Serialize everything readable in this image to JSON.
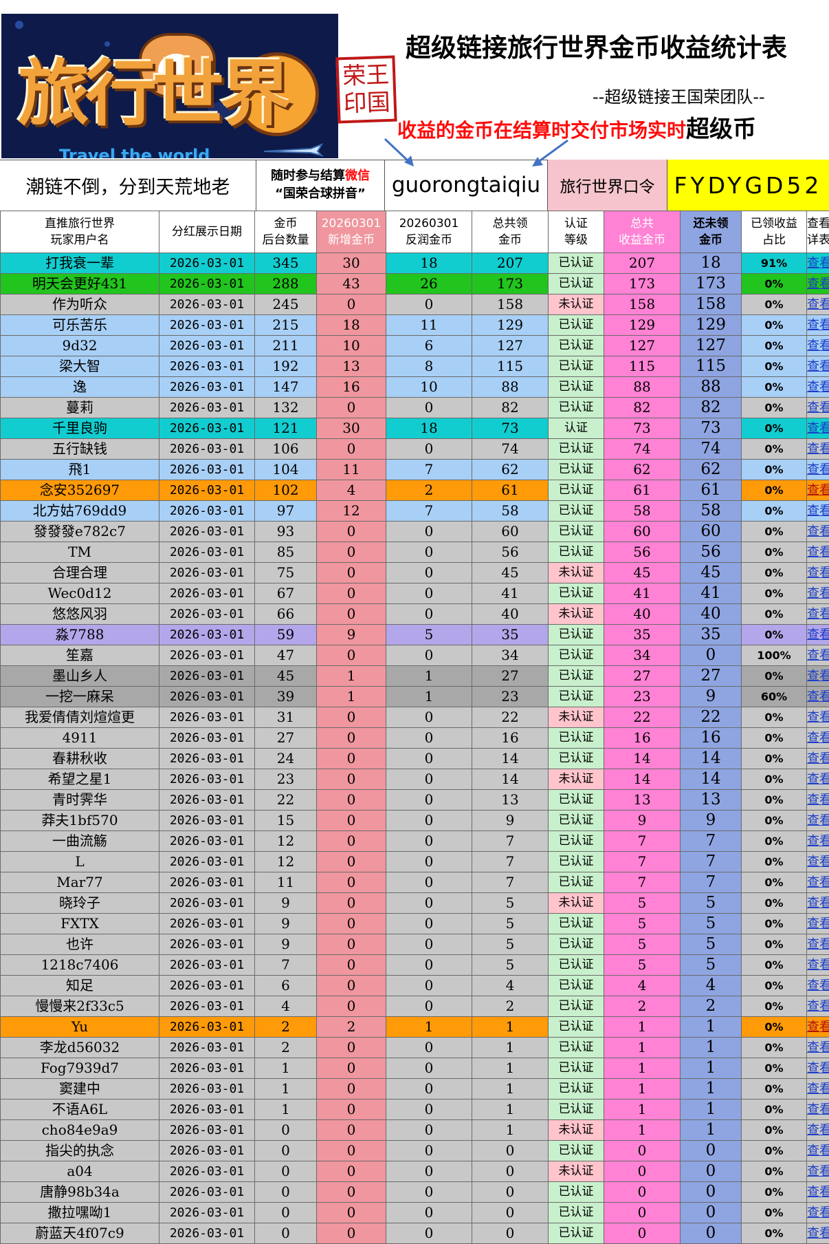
{
  "banner": {
    "logo_text": "旅行世界",
    "logo_sub": "Travel the world",
    "stamp_chars": [
      "荣",
      "王",
      "印",
      "国"
    ],
    "title": "超级链接旅行世界金币收益统计表",
    "team": "--超级链接王国荣团队--",
    "notice_red": "收益的金币在结算时交付市场实时",
    "notice_black": "超级币"
  },
  "info": {
    "slogan": "潮链不倒，分到天荒地老",
    "join_line1_a": "随时参与结算",
    "join_line1_b": "微信",
    "join_line2": "“国荣合球拼音”",
    "wechat_id": "guorongtaiqiu",
    "code_label": "旅行世界口令",
    "code_value": "FYDYGD52"
  },
  "headers": {
    "col1": [
      "直推旅行世界",
      "玩家用户名"
    ],
    "col2": [
      "分红展示日期"
    ],
    "col3": [
      "金币",
      "后台数量"
    ],
    "col4": [
      "20260301",
      "新增金币"
    ],
    "col5": [
      "20260301",
      "反润金币"
    ],
    "col6": [
      "总共领",
      "金币"
    ],
    "col7": [
      "认证",
      "等级"
    ],
    "col8": [
      "总共",
      "收益金币"
    ],
    "col9": [
      "还未领",
      "金币"
    ],
    "col10": [
      "已领收益",
      "占比"
    ],
    "col11": [
      "查看",
      "详表"
    ]
  },
  "link_text": "查看",
  "colors": {
    "teal": "#12cdd0",
    "green": "#22c41e",
    "gray": "#c8c8c8",
    "blue": "#a8cff6",
    "orange": "#ff9a08",
    "purple": "#b4a6ea",
    "darkgray": "#a8a8a8",
    "pink_new": "#f0969e",
    "pink_total": "#ff82d4",
    "cert_green": "#c8f0cc",
    "cert_pink": "#ffc4cc",
    "unclaimed": "#8fa5e2",
    "code_bg": "#ffff00",
    "code_label_bg": "#f5c4cc"
  },
  "rows": [
    {
      "name": "打我衰一辈",
      "date": "2026-03-01",
      "backend": "345",
      "added": "30",
      "rebate": "18",
      "claimed": "207",
      "cert": "已认证",
      "total": "207",
      "unclaimed": "18",
      "pct": "91%",
      "style": "teal"
    },
    {
      "name": "明天会更好431",
      "date": "2026-03-01",
      "backend": "288",
      "added": "43",
      "rebate": "26",
      "claimed": "173",
      "cert": "已认证",
      "total": "173",
      "unclaimed": "173",
      "pct": "0%",
      "style": "green"
    },
    {
      "name": "作为听众",
      "date": "2026-03-01",
      "backend": "245",
      "added": "0",
      "rebate": "0",
      "claimed": "158",
      "cert": "未认证",
      "total": "158",
      "unclaimed": "158",
      "pct": "0%",
      "style": "gray"
    },
    {
      "name": "可乐苦乐",
      "date": "2026-03-01",
      "backend": "215",
      "added": "18",
      "rebate": "11",
      "claimed": "129",
      "cert": "已认证",
      "total": "129",
      "unclaimed": "129",
      "pct": "0%",
      "style": "blue"
    },
    {
      "name": "9d32",
      "date": "2026-03-01",
      "backend": "211",
      "added": "10",
      "rebate": "6",
      "claimed": "127",
      "cert": "已认证",
      "total": "127",
      "unclaimed": "127",
      "pct": "0%",
      "style": "blue"
    },
    {
      "name": "梁大智",
      "date": "2026-03-01",
      "backend": "192",
      "added": "13",
      "rebate": "8",
      "claimed": "115",
      "cert": "已认证",
      "total": "115",
      "unclaimed": "115",
      "pct": "0%",
      "style": "blue"
    },
    {
      "name": "逸",
      "date": "2026-03-01",
      "backend": "147",
      "added": "16",
      "rebate": "10",
      "claimed": "88",
      "cert": "已认证",
      "total": "88",
      "unclaimed": "88",
      "pct": "0%",
      "style": "blue"
    },
    {
      "name": "蔓莉",
      "date": "2026-03-01",
      "backend": "132",
      "added": "0",
      "rebate": "0",
      "claimed": "82",
      "cert": "已认证",
      "total": "82",
      "unclaimed": "82",
      "pct": "0%",
      "style": "gray"
    },
    {
      "name": "千里良驹",
      "date": "2026-03-01",
      "backend": "121",
      "added": "30",
      "rebate": "18",
      "claimed": "73",
      "cert": "认证",
      "total": "73",
      "unclaimed": "73",
      "pct": "0%",
      "style": "teal"
    },
    {
      "name": "五行缺钱",
      "date": "2026-03-01",
      "backend": "106",
      "added": "0",
      "rebate": "0",
      "claimed": "74",
      "cert": "已认证",
      "total": "74",
      "unclaimed": "74",
      "pct": "0%",
      "style": "gray"
    },
    {
      "name": "飛1",
      "date": "2026-03-01",
      "backend": "104",
      "added": "11",
      "rebate": "7",
      "claimed": "62",
      "cert": "已认证",
      "total": "62",
      "unclaimed": "62",
      "pct": "0%",
      "style": "blue"
    },
    {
      "name": "念安352697",
      "date": "2026-03-01",
      "backend": "102",
      "added": "4",
      "rebate": "2",
      "claimed": "61",
      "cert": "已认证",
      "total": "61",
      "unclaimed": "61",
      "pct": "0%",
      "style": "orange"
    },
    {
      "name": "北方姑769dd9",
      "date": "2026-03-01",
      "backend": "97",
      "added": "12",
      "rebate": "7",
      "claimed": "58",
      "cert": "已认证",
      "total": "58",
      "unclaimed": "58",
      "pct": "0%",
      "style": "blue"
    },
    {
      "name": "發發發e782c7",
      "date": "2026-03-01",
      "backend": "93",
      "added": "0",
      "rebate": "0",
      "claimed": "60",
      "cert": "已认证",
      "total": "60",
      "unclaimed": "60",
      "pct": "0%",
      "style": "gray"
    },
    {
      "name": "TM",
      "date": "2026-03-01",
      "backend": "85",
      "added": "0",
      "rebate": "0",
      "claimed": "56",
      "cert": "已认证",
      "total": "56",
      "unclaimed": "56",
      "pct": "0%",
      "style": "gray"
    },
    {
      "name": "合理合理",
      "date": "2026-03-01",
      "backend": "75",
      "added": "0",
      "rebate": "0",
      "claimed": "45",
      "cert": "未认证",
      "total": "45",
      "unclaimed": "45",
      "pct": "0%",
      "style": "gray"
    },
    {
      "name": "Wec0d12",
      "date": "2026-03-01",
      "backend": "67",
      "added": "0",
      "rebate": "0",
      "claimed": "41",
      "cert": "已认证",
      "total": "41",
      "unclaimed": "41",
      "pct": "0%",
      "style": "gray"
    },
    {
      "name": "悠悠风羽",
      "date": "2026-03-01",
      "backend": "66",
      "added": "0",
      "rebate": "0",
      "claimed": "40",
      "cert": "未认证",
      "total": "40",
      "unclaimed": "40",
      "pct": "0%",
      "style": "gray"
    },
    {
      "name": "淼7788",
      "date": "2026-03-01",
      "backend": "59",
      "added": "9",
      "rebate": "5",
      "claimed": "35",
      "cert": "已认证",
      "total": "35",
      "unclaimed": "35",
      "pct": "0%",
      "style": "purple"
    },
    {
      "name": "笙嘉",
      "date": "2026-03-01",
      "backend": "47",
      "added": "0",
      "rebate": "0",
      "claimed": "34",
      "cert": "已认证",
      "total": "34",
      "unclaimed": "0",
      "pct": "100%",
      "style": "gray"
    },
    {
      "name": "墨山乡人",
      "date": "2026-03-01",
      "backend": "45",
      "added": "1",
      "rebate": "1",
      "claimed": "27",
      "cert": "已认证",
      "total": "27",
      "unclaimed": "27",
      "pct": "0%",
      "style": "darkgray"
    },
    {
      "name": "一挖一麻呆",
      "date": "2026-03-01",
      "backend": "39",
      "added": "1",
      "rebate": "1",
      "claimed": "23",
      "cert": "已认证",
      "total": "23",
      "unclaimed": "9",
      "pct": "60%",
      "style": "darkgray"
    },
    {
      "name": "我爱倩倩刘煊煊更",
      "date": "2026-03-01",
      "backend": "31",
      "added": "0",
      "rebate": "0",
      "claimed": "22",
      "cert": "未认证",
      "total": "22",
      "unclaimed": "22",
      "pct": "0%",
      "style": "gray"
    },
    {
      "name": "4911",
      "date": "2026-03-01",
      "backend": "27",
      "added": "0",
      "rebate": "0",
      "claimed": "16",
      "cert": "已认证",
      "total": "16",
      "unclaimed": "16",
      "pct": "0%",
      "style": "gray"
    },
    {
      "name": "春耕秋收",
      "date": "2026-03-01",
      "backend": "24",
      "added": "0",
      "rebate": "0",
      "claimed": "14",
      "cert": "已认证",
      "total": "14",
      "unclaimed": "14",
      "pct": "0%",
      "style": "gray"
    },
    {
      "name": "希望之星1",
      "date": "2026-03-01",
      "backend": "23",
      "added": "0",
      "rebate": "0",
      "claimed": "14",
      "cert": "未认证",
      "total": "14",
      "unclaimed": "14",
      "pct": "0%",
      "style": "gray"
    },
    {
      "name": "青时霁华",
      "date": "2026-03-01",
      "backend": "22",
      "added": "0",
      "rebate": "0",
      "claimed": "13",
      "cert": "已认证",
      "total": "13",
      "unclaimed": "13",
      "pct": "0%",
      "style": "gray"
    },
    {
      "name": "莽夫1bf570",
      "date": "2026-03-01",
      "backend": "15",
      "added": "0",
      "rebate": "0",
      "claimed": "9",
      "cert": "已认证",
      "total": "9",
      "unclaimed": "9",
      "pct": "0%",
      "style": "gray"
    },
    {
      "name": "一曲流觞",
      "date": "2026-03-01",
      "backend": "12",
      "added": "0",
      "rebate": "0",
      "claimed": "7",
      "cert": "已认证",
      "total": "7",
      "unclaimed": "7",
      "pct": "0%",
      "style": "gray"
    },
    {
      "name": "L",
      "date": "2026-03-01",
      "backend": "12",
      "added": "0",
      "rebate": "0",
      "claimed": "7",
      "cert": "已认证",
      "total": "7",
      "unclaimed": "7",
      "pct": "0%",
      "style": "gray"
    },
    {
      "name": "Mar77",
      "date": "2026-03-01",
      "backend": "11",
      "added": "0",
      "rebate": "0",
      "claimed": "7",
      "cert": "已认证",
      "total": "7",
      "unclaimed": "7",
      "pct": "0%",
      "style": "gray"
    },
    {
      "name": "晓玲子",
      "date": "2026-03-01",
      "backend": "9",
      "added": "0",
      "rebate": "0",
      "claimed": "5",
      "cert": "未认证",
      "total": "5",
      "unclaimed": "5",
      "pct": "0%",
      "style": "gray"
    },
    {
      "name": "FXTX",
      "date": "2026-03-01",
      "backend": "9",
      "added": "0",
      "rebate": "0",
      "claimed": "5",
      "cert": "已认证",
      "total": "5",
      "unclaimed": "5",
      "pct": "0%",
      "style": "gray"
    },
    {
      "name": "也许",
      "date": "2026-03-01",
      "backend": "9",
      "added": "0",
      "rebate": "0",
      "claimed": "5",
      "cert": "已认证",
      "total": "5",
      "unclaimed": "5",
      "pct": "0%",
      "style": "gray"
    },
    {
      "name": "1218c7406",
      "date": "2026-03-01",
      "backend": "7",
      "added": "0",
      "rebate": "0",
      "claimed": "5",
      "cert": "已认证",
      "total": "5",
      "unclaimed": "5",
      "pct": "0%",
      "style": "gray"
    },
    {
      "name": "知足",
      "date": "2026-03-01",
      "backend": "6",
      "added": "0",
      "rebate": "0",
      "claimed": "4",
      "cert": "已认证",
      "total": "4",
      "unclaimed": "4",
      "pct": "0%",
      "style": "gray"
    },
    {
      "name": "慢慢来2f33c5",
      "date": "2026-03-01",
      "backend": "4",
      "added": "0",
      "rebate": "0",
      "claimed": "2",
      "cert": "已认证",
      "total": "2",
      "unclaimed": "2",
      "pct": "0%",
      "style": "gray"
    },
    {
      "name": "Yu",
      "date": "2026-03-01",
      "backend": "2",
      "added": "2",
      "rebate": "1",
      "claimed": "1",
      "cert": "已认证",
      "total": "1",
      "unclaimed": "1",
      "pct": "0%",
      "style": "orange"
    },
    {
      "name": "李龙d56032",
      "date": "2026-03-01",
      "backend": "2",
      "added": "0",
      "rebate": "0",
      "claimed": "1",
      "cert": "已认证",
      "total": "1",
      "unclaimed": "1",
      "pct": "0%",
      "style": "gray"
    },
    {
      "name": "Fog7939d7",
      "date": "2026-03-01",
      "backend": "1",
      "added": "0",
      "rebate": "0",
      "claimed": "1",
      "cert": "已认证",
      "total": "1",
      "unclaimed": "1",
      "pct": "0%",
      "style": "gray"
    },
    {
      "name": "窦建中",
      "date": "2026-03-01",
      "backend": "1",
      "added": "0",
      "rebate": "0",
      "claimed": "1",
      "cert": "已认证",
      "total": "1",
      "unclaimed": "1",
      "pct": "0%",
      "style": "gray"
    },
    {
      "name": "不语A6L",
      "date": "2026-03-01",
      "backend": "1",
      "added": "0",
      "rebate": "0",
      "claimed": "1",
      "cert": "已认证",
      "total": "1",
      "unclaimed": "1",
      "pct": "0%",
      "style": "gray"
    },
    {
      "name": "cho84e9a9",
      "date": "2026-03-01",
      "backend": "0",
      "added": "0",
      "rebate": "0",
      "claimed": "1",
      "cert": "未认证",
      "total": "1",
      "unclaimed": "1",
      "pct": "0%",
      "style": "gray"
    },
    {
      "name": "指尖的执念",
      "date": "2026-03-01",
      "backend": "0",
      "added": "0",
      "rebate": "0",
      "claimed": "0",
      "cert": "已认证",
      "total": "0",
      "unclaimed": "0",
      "pct": "0%",
      "style": "gray"
    },
    {
      "name": "a04",
      "date": "2026-03-01",
      "backend": "0",
      "added": "0",
      "rebate": "0",
      "claimed": "0",
      "cert": "未认证",
      "total": "0",
      "unclaimed": "0",
      "pct": "0%",
      "style": "gray"
    },
    {
      "name": "唐静98b34a",
      "date": "2026-03-01",
      "backend": "0",
      "added": "0",
      "rebate": "0",
      "claimed": "0",
      "cert": "已认证",
      "total": "0",
      "unclaimed": "0",
      "pct": "0%",
      "style": "gray"
    },
    {
      "name": "撒拉嘿呦1",
      "date": "2026-03-01",
      "backend": "0",
      "added": "0",
      "rebate": "0",
      "claimed": "0",
      "cert": "已认证",
      "total": "0",
      "unclaimed": "0",
      "pct": "0%",
      "style": "gray"
    },
    {
      "name": "蔚蓝天4f07c9",
      "date": "2026-03-01",
      "backend": "0",
      "added": "0",
      "rebate": "0",
      "claimed": "0",
      "cert": "已认证",
      "total": "0",
      "unclaimed": "0",
      "pct": "0%",
      "style": "gray"
    }
  ]
}
